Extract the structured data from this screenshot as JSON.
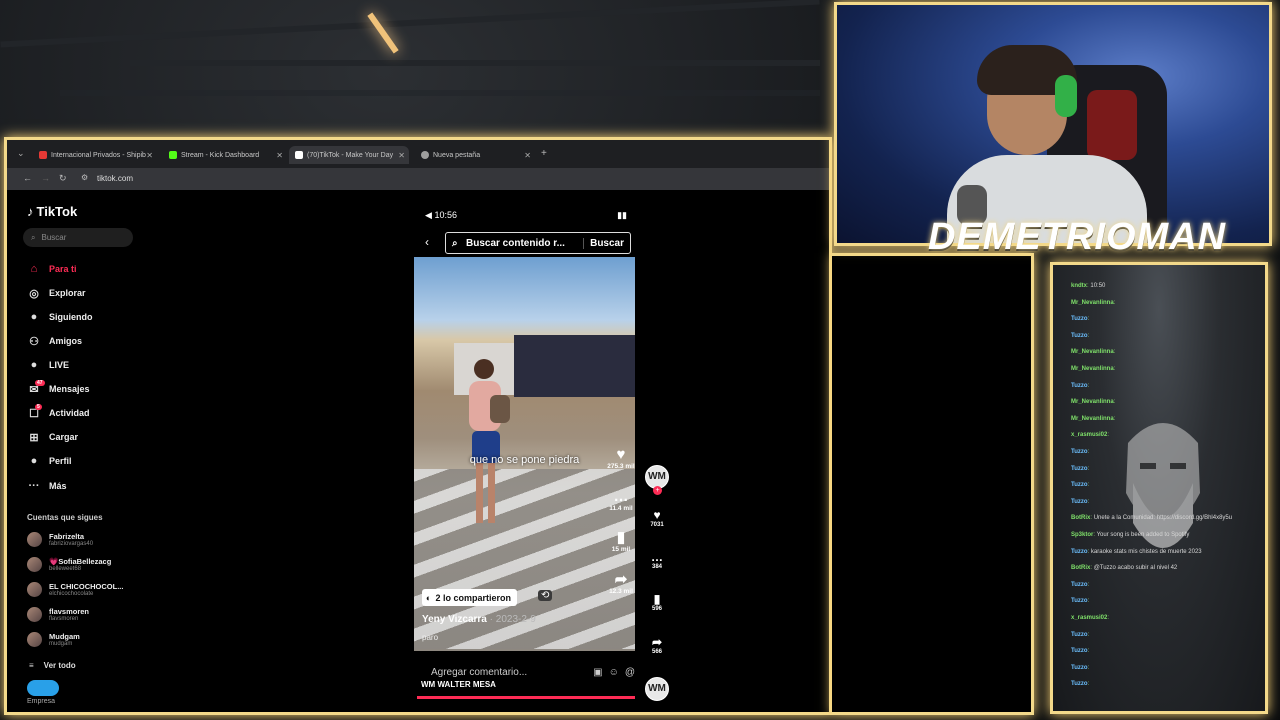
{
  "browser": {
    "tabs": [
      {
        "title": "Internacional Privados - Shipib",
        "color": "#e53935"
      },
      {
        "title": "Stream - Kick Dashboard",
        "color": "#53fc18"
      },
      {
        "title": "(70)TikTok - Make Your Day",
        "color": "#ffffff"
      },
      {
        "title": "Nueva pestaña",
        "color": "#9e9e9e"
      }
    ],
    "new_tab": "+",
    "url": "tiktok.com"
  },
  "tiktok": {
    "logo": "TikTok",
    "search_placeholder": "Buscar",
    "menu": [
      {
        "label": "Para ti",
        "icon": "home-icon",
        "glyph": "⌂"
      },
      {
        "label": "Explorar",
        "icon": "compass-icon",
        "glyph": "◎"
      },
      {
        "label": "Siguiendo",
        "icon": "following-icon",
        "glyph": "●"
      },
      {
        "label": "Amigos",
        "icon": "friends-icon",
        "glyph": "⚇"
      },
      {
        "label": "LIVE",
        "icon": "live-icon",
        "glyph": "●"
      },
      {
        "label": "Mensajes",
        "icon": "messages-icon",
        "glyph": "✉",
        "badge": "47"
      },
      {
        "label": "Actividad",
        "icon": "activity-icon",
        "glyph": "☐",
        "badge": "5"
      },
      {
        "label": "Cargar",
        "icon": "upload-icon",
        "glyph": "⊞"
      },
      {
        "label": "Perfil",
        "icon": "profile-icon",
        "glyph": "●"
      },
      {
        "label": "Más",
        "icon": "more-icon",
        "glyph": "···"
      }
    ],
    "following_title": "Cuentas que sigues",
    "following": [
      {
        "name": "Fabrizelta",
        "handle": "fabriziovargas40"
      },
      {
        "name": "💗SofiaBellezacg",
        "handle": "belleweet68"
      },
      {
        "name": "EL CHICOCHOCOL...",
        "handle": "elchicochocolate"
      },
      {
        "name": "flavsmoren",
        "handle": "flavsmoren"
      },
      {
        "name": "Mudgam",
        "handle": "mudgam"
      }
    ],
    "see_all": "Ver todo",
    "company_label": "Empresa"
  },
  "phone": {
    "time": "10:56",
    "search_query": "Buscar contenido r...",
    "search_button": "Buscar",
    "caption": "que no se pone piedra",
    "overlay_actions": [
      {
        "icon": "heart-icon",
        "glyph": "♥",
        "count": "275.3 mil"
      },
      {
        "icon": "comment-icon",
        "glyph": "…",
        "count": "11.4 mil"
      },
      {
        "icon": "bookmark-icon",
        "glyph": "▮",
        "count": "15 mil"
      },
      {
        "icon": "share-icon",
        "glyph": "➦",
        "count": "12.3 mil"
      }
    ],
    "shared_label": "2 lo compartieron",
    "author": "Yeny Vizcarra",
    "date": "· 2023-2-9",
    "description": "paro",
    "comment_placeholder": "Agregar comentario...",
    "music": "WM WALTER MESA",
    "side_actions": [
      {
        "icon": "heart-icon",
        "glyph": "♥",
        "count": "7031"
      },
      {
        "icon": "comment-icon",
        "glyph": "…",
        "count": "384"
      },
      {
        "icon": "bookmark-icon",
        "glyph": "▮",
        "count": "596"
      },
      {
        "icon": "share-icon",
        "glyph": "➦",
        "count": "566"
      }
    ],
    "avatar_text": "WM"
  },
  "stream": {
    "name": "DEMETRIOMAN"
  },
  "chat": {
    "lines": [
      {
        "user": "kndtx",
        "msg": "10:50",
        "green": true
      },
      {
        "user": "Mr_Nevanlinna",
        "msg": "",
        "green": true
      },
      {
        "user": "Tuzzo",
        "msg": "",
        "green": false
      },
      {
        "user": "Tuzzo",
        "msg": "",
        "green": false
      },
      {
        "user": "Mr_Nevanlinna",
        "msg": "",
        "green": true
      },
      {
        "user": "Mr_Nevanlinna",
        "msg": "",
        "green": true
      },
      {
        "user": "Tuzzo",
        "msg": "",
        "green": false
      },
      {
        "user": "Mr_Nevanlinna",
        "msg": "",
        "green": true
      },
      {
        "user": "Mr_Nevanlinna",
        "msg": "",
        "green": true
      },
      {
        "user": "x_rasmusi02",
        "msg": "",
        "green": true
      },
      {
        "user": "Tuzzo",
        "msg": "",
        "green": false
      },
      {
        "user": "Tuzzo",
        "msg": "",
        "green": false
      },
      {
        "user": "Tuzzo",
        "msg": "",
        "green": false
      },
      {
        "user": "Tuzzo",
        "msg": "",
        "green": false
      },
      {
        "user": "BotRix",
        "msg": "Unete a la Comunidad: https://discord.gg/Bhl4x8y5u",
        "green": true
      },
      {
        "user": "Sp3ktor",
        "msg": "Your song is been added to Spotify",
        "green": true
      },
      {
        "user": "Tuzzo",
        "msg": "karaoke stats mis chistes de muerte 2023",
        "green": false
      },
      {
        "user": "BotRix",
        "msg": "@Tuzzo acabo subir al nivel 42",
        "green": true
      },
      {
        "user": "Tuzzo",
        "msg": "",
        "green": false
      },
      {
        "user": "Tuzzo",
        "msg": "",
        "green": false
      },
      {
        "user": "x_rasmusi02",
        "msg": "",
        "green": true
      },
      {
        "user": "Tuzzo",
        "msg": "",
        "green": false
      },
      {
        "user": "Tuzzo",
        "msg": "",
        "green": false
      },
      {
        "user": "Tuzzo",
        "msg": "",
        "green": false
      },
      {
        "user": "Tuzzo",
        "msg": "",
        "green": false
      }
    ]
  }
}
